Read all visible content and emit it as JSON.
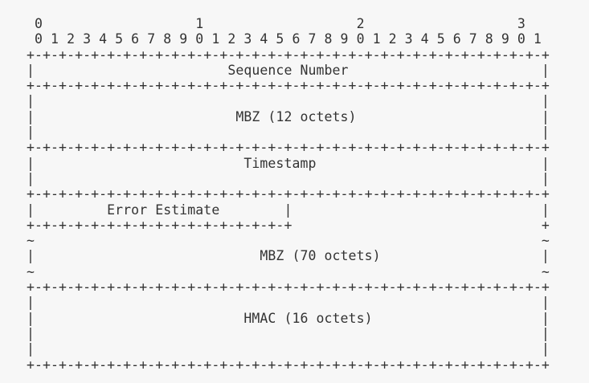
{
  "diagram": {
    "lines": [
      " 0                   1                   2                   3",
      " 0 1 2 3 4 5 6 7 8 9 0 1 2 3 4 5 6 7 8 9 0 1 2 3 4 5 6 7 8 9 0 1",
      "+-+-+-+-+-+-+-+-+-+-+-+-+-+-+-+-+-+-+-+-+-+-+-+-+-+-+-+-+-+-+-+-+",
      "|                        Sequence Number                        |",
      "+-+-+-+-+-+-+-+-+-+-+-+-+-+-+-+-+-+-+-+-+-+-+-+-+-+-+-+-+-+-+-+-+",
      "|                                                               |",
      "|                         MBZ (12 octets)                       |",
      "|                                                               |",
      "+-+-+-+-+-+-+-+-+-+-+-+-+-+-+-+-+-+-+-+-+-+-+-+-+-+-+-+-+-+-+-+-+",
      "|                          Timestamp                            |",
      "|                                                               |",
      "+-+-+-+-+-+-+-+-+-+-+-+-+-+-+-+-+-+-+-+-+-+-+-+-+-+-+-+-+-+-+-+-+",
      "|         Error Estimate        |                               |",
      "+-+-+-+-+-+-+-+-+-+-+-+-+-+-+-+-+                               +",
      "~                                                               ~",
      "|                            MBZ (70 octets)                    |",
      "~                                                               ~",
      "+-+-+-+-+-+-+-+-+-+-+-+-+-+-+-+-+-+-+-+-+-+-+-+-+-+-+-+-+-+-+-+-+",
      "|                                                               |",
      "|                          HMAC (16 octets)                     |",
      "|                                                               |",
      "|                                                               |",
      "+-+-+-+-+-+-+-+-+-+-+-+-+-+-+-+-+-+-+-+-+-+-+-+-+-+-+-+-+-+-+-+-+"
    ]
  }
}
